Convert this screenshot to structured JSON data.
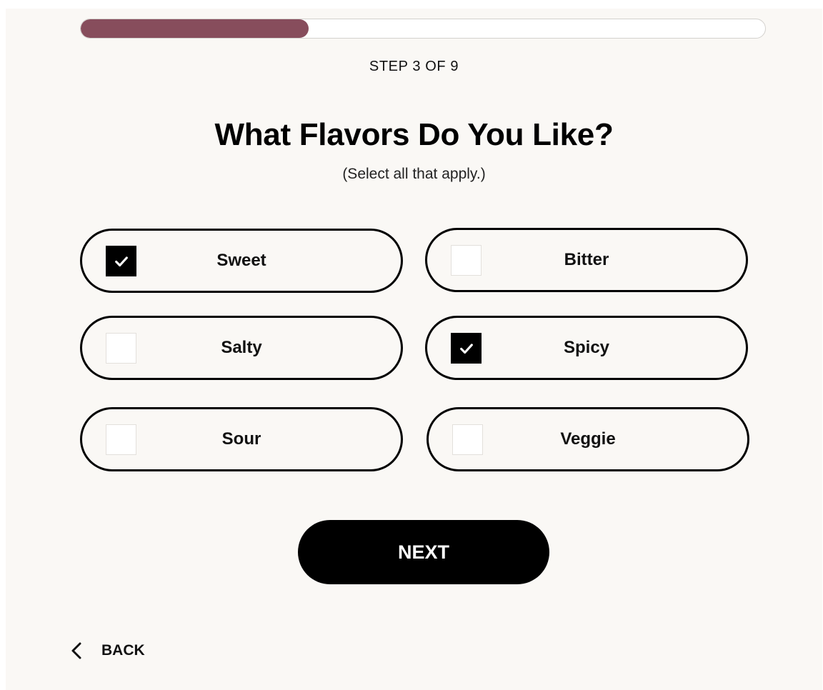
{
  "progress": {
    "fraction": 0.333,
    "fill_color": "#874d5c",
    "step_text": "STEP 3 OF 9"
  },
  "title": "What Flavors Do You Like?",
  "subtitle": "(Select all that apply.)",
  "options": [
    {
      "label": "Sweet",
      "checked": true
    },
    {
      "label": "Bitter",
      "checked": false
    },
    {
      "label": "Salty",
      "checked": false
    },
    {
      "label": "Spicy",
      "checked": true
    },
    {
      "label": "Sour",
      "checked": false
    },
    {
      "label": "Veggie",
      "checked": false
    }
  ],
  "next_label": "NEXT",
  "back_label": "BACK",
  "icons": {
    "check": "check-icon",
    "back": "chevron-left-icon"
  }
}
